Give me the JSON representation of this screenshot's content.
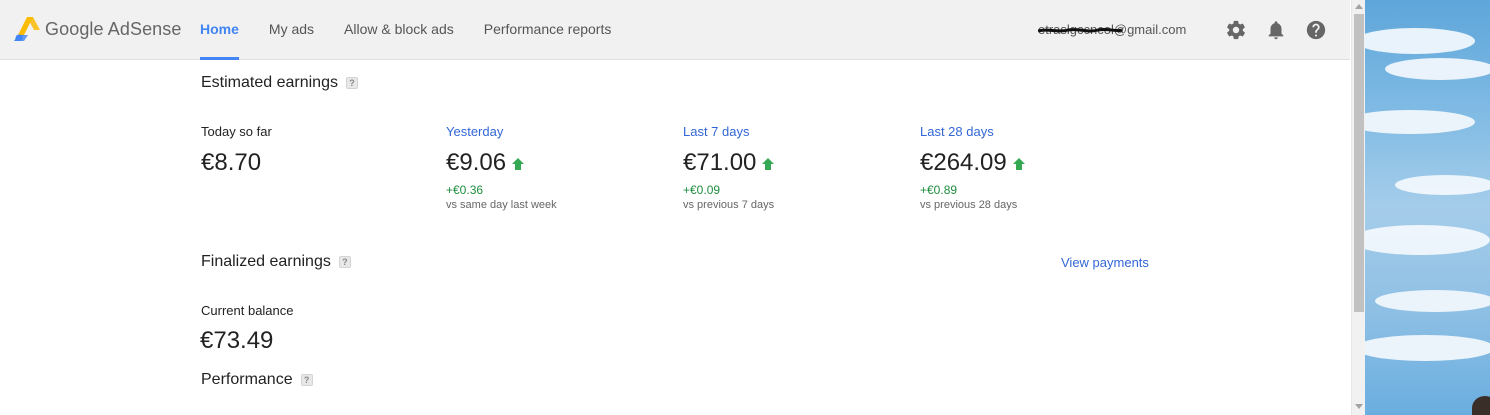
{
  "app": {
    "brand": "Google AdSense",
    "nav": [
      {
        "label": "Home",
        "active": true
      },
      {
        "label": "My ads"
      },
      {
        "label": "Allow & block ads"
      },
      {
        "label": "Performance reports"
      }
    ],
    "account_email": "etraslgccncol@gmail.com",
    "icons": [
      "gear-icon",
      "bell-icon",
      "help-icon"
    ]
  },
  "estimated": {
    "title": "Estimated earnings",
    "help": "?",
    "metrics": [
      {
        "label": "Today so far",
        "value": "€8.70"
      },
      {
        "label": "Yesterday",
        "value": "€9.06",
        "change": "+€0.36",
        "note": "vs same day last week"
      },
      {
        "label": "Last 7 days",
        "value": "€71.00",
        "change": "+€0.09",
        "note": "vs previous 7 days"
      },
      {
        "label": "Last 28 days",
        "value": "€264.09",
        "change": "+€0.89",
        "note": "vs previous 28 days"
      }
    ]
  },
  "finalized": {
    "title": "Finalized earnings",
    "help": "?",
    "view_payments": "View payments",
    "balance_label": "Current balance",
    "balance_value": "€73.49"
  },
  "performance": {
    "title": "Performance",
    "help": "?"
  },
  "colors": {
    "accent": "#4285f4",
    "link": "#3367d6",
    "positive": "#1e8e3e",
    "topbar": "#f1f1f1"
  }
}
